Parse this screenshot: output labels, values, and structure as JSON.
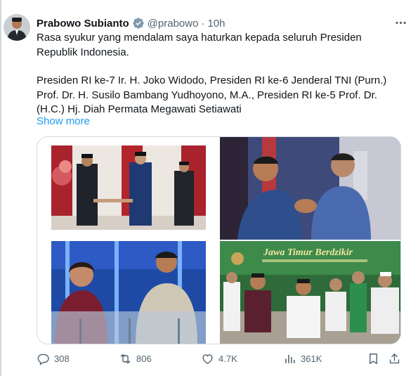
{
  "author": {
    "name": "Prabowo Subianto",
    "handle": "@prabowo",
    "separator": "·",
    "time": "10h"
  },
  "tweet": {
    "paragraph1": "Rasa syukur yang mendalam saya haturkan kepada seluruh Presiden Republik Indonesia.",
    "paragraph2": "Presiden RI ke-7 Ir. H. Joko Widodo, Presiden RI ke-6 Jenderal TNI (Purn.) Prof. Dr. H. Susilo Bambang Yudhoyono, M.A., Presiden RI ke-5 Prof. Dr. (H.C.) Hj. Diah Permata Megawati Setiawati",
    "show_more": "Show more"
  },
  "media": {
    "photo4_banner": "Jawa Timur Berdzikir"
  },
  "actions": {
    "replies": "308",
    "reposts": "806",
    "likes": "4.7K",
    "views": "361K"
  },
  "colors": {
    "accent": "#1d9bf0",
    "text": "#0f1419",
    "secondary": "#536471",
    "border": "#cfd9de"
  }
}
